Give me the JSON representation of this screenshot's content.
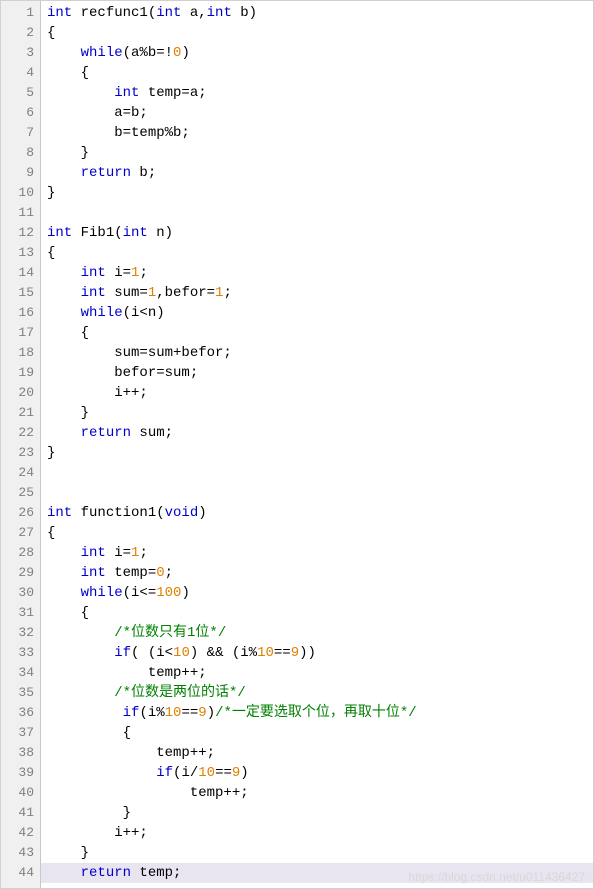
{
  "watermark": "https://blog.csdn.net/u011436427",
  "lines": [
    {
      "n": 1,
      "indent": 0,
      "segs": [
        {
          "t": "int ",
          "c": "kw"
        },
        {
          "t": "recfunc1(",
          "c": ""
        },
        {
          "t": "int ",
          "c": "kw"
        },
        {
          "t": "a,",
          "c": ""
        },
        {
          "t": "int ",
          "c": "kw"
        },
        {
          "t": "b)",
          "c": ""
        }
      ]
    },
    {
      "n": 2,
      "indent": 0,
      "segs": [
        {
          "t": "{",
          "c": ""
        }
      ]
    },
    {
      "n": 3,
      "indent": 1,
      "segs": [
        {
          "t": "while",
          "c": "kw"
        },
        {
          "t": "(a%b=!",
          "c": ""
        },
        {
          "t": "0",
          "c": "num"
        },
        {
          "t": ")",
          "c": ""
        }
      ]
    },
    {
      "n": 4,
      "indent": 1,
      "segs": [
        {
          "t": "{",
          "c": ""
        }
      ]
    },
    {
      "n": 5,
      "indent": 2,
      "segs": [
        {
          "t": "int ",
          "c": "kw"
        },
        {
          "t": "temp=a;",
          "c": ""
        }
      ]
    },
    {
      "n": 6,
      "indent": 2,
      "segs": [
        {
          "t": "a=b;",
          "c": ""
        }
      ]
    },
    {
      "n": 7,
      "indent": 2,
      "segs": [
        {
          "t": "b=temp%b;",
          "c": ""
        }
      ]
    },
    {
      "n": 8,
      "indent": 1,
      "segs": [
        {
          "t": "}",
          "c": ""
        }
      ]
    },
    {
      "n": 9,
      "indent": 1,
      "segs": [
        {
          "t": "return ",
          "c": "kw"
        },
        {
          "t": "b;",
          "c": ""
        }
      ]
    },
    {
      "n": 10,
      "indent": 0,
      "segs": [
        {
          "t": "}",
          "c": ""
        }
      ]
    },
    {
      "n": 11,
      "indent": 0,
      "segs": []
    },
    {
      "n": 12,
      "indent": 0,
      "segs": [
        {
          "t": "int ",
          "c": "kw"
        },
        {
          "t": "Fib1(",
          "c": ""
        },
        {
          "t": "int ",
          "c": "kw"
        },
        {
          "t": "n)",
          "c": ""
        }
      ]
    },
    {
      "n": 13,
      "indent": 0,
      "segs": [
        {
          "t": "{",
          "c": ""
        }
      ]
    },
    {
      "n": 14,
      "indent": 1,
      "segs": [
        {
          "t": "int ",
          "c": "kw"
        },
        {
          "t": "i=",
          "c": ""
        },
        {
          "t": "1",
          "c": "num"
        },
        {
          "t": ";",
          "c": ""
        }
      ]
    },
    {
      "n": 15,
      "indent": 1,
      "segs": [
        {
          "t": "int ",
          "c": "kw"
        },
        {
          "t": "sum=",
          "c": ""
        },
        {
          "t": "1",
          "c": "num"
        },
        {
          "t": ",befor=",
          "c": ""
        },
        {
          "t": "1",
          "c": "num"
        },
        {
          "t": ";",
          "c": ""
        }
      ]
    },
    {
      "n": 16,
      "indent": 1,
      "segs": [
        {
          "t": "while",
          "c": "kw"
        },
        {
          "t": "(i<n)",
          "c": ""
        }
      ]
    },
    {
      "n": 17,
      "indent": 1,
      "segs": [
        {
          "t": "{",
          "c": ""
        }
      ]
    },
    {
      "n": 18,
      "indent": 2,
      "segs": [
        {
          "t": "sum=sum+befor;",
          "c": ""
        }
      ]
    },
    {
      "n": 19,
      "indent": 2,
      "segs": [
        {
          "t": "befor=sum;",
          "c": ""
        }
      ]
    },
    {
      "n": 20,
      "indent": 2,
      "segs": [
        {
          "t": "i++;",
          "c": ""
        }
      ]
    },
    {
      "n": 21,
      "indent": 1,
      "segs": [
        {
          "t": "}",
          "c": ""
        }
      ]
    },
    {
      "n": 22,
      "indent": 1,
      "segs": [
        {
          "t": "return ",
          "c": "kw"
        },
        {
          "t": "sum;",
          "c": ""
        }
      ]
    },
    {
      "n": 23,
      "indent": 0,
      "segs": [
        {
          "t": "}",
          "c": ""
        }
      ]
    },
    {
      "n": 24,
      "indent": 0,
      "segs": []
    },
    {
      "n": 25,
      "indent": 0,
      "segs": []
    },
    {
      "n": 26,
      "indent": 0,
      "segs": [
        {
          "t": "int ",
          "c": "kw"
        },
        {
          "t": "function1(",
          "c": ""
        },
        {
          "t": "void",
          "c": "kw"
        },
        {
          "t": ")",
          "c": ""
        }
      ]
    },
    {
      "n": 27,
      "indent": 0,
      "segs": [
        {
          "t": "{",
          "c": ""
        }
      ]
    },
    {
      "n": 28,
      "indent": 1,
      "segs": [
        {
          "t": "int ",
          "c": "kw"
        },
        {
          "t": "i=",
          "c": ""
        },
        {
          "t": "1",
          "c": "num"
        },
        {
          "t": ";",
          "c": ""
        }
      ]
    },
    {
      "n": 29,
      "indent": 1,
      "segs": [
        {
          "t": "int ",
          "c": "kw"
        },
        {
          "t": "temp=",
          "c": ""
        },
        {
          "t": "0",
          "c": "num"
        },
        {
          "t": ";",
          "c": ""
        }
      ]
    },
    {
      "n": 30,
      "indent": 1,
      "segs": [
        {
          "t": "while",
          "c": "kw"
        },
        {
          "t": "(i<=",
          "c": ""
        },
        {
          "t": "100",
          "c": "num"
        },
        {
          "t": ")",
          "c": ""
        }
      ]
    },
    {
      "n": 31,
      "indent": 1,
      "segs": [
        {
          "t": "{",
          "c": ""
        }
      ]
    },
    {
      "n": 32,
      "indent": 2,
      "segs": [
        {
          "t": "/*位数只有1位*/",
          "c": "comment"
        }
      ]
    },
    {
      "n": 33,
      "indent": 2,
      "segs": [
        {
          "t": "if",
          "c": "kw"
        },
        {
          "t": "( (i<",
          "c": ""
        },
        {
          "t": "10",
          "c": "num"
        },
        {
          "t": ") && (i%",
          "c": ""
        },
        {
          "t": "10",
          "c": "num"
        },
        {
          "t": "==",
          "c": ""
        },
        {
          "t": "9",
          "c": "num"
        },
        {
          "t": "))",
          "c": ""
        }
      ]
    },
    {
      "n": 34,
      "indent": 3,
      "segs": [
        {
          "t": "temp++;",
          "c": ""
        }
      ]
    },
    {
      "n": 35,
      "indent": 2,
      "segs": [
        {
          "t": "/*位数是两位的话*/",
          "c": "comment"
        }
      ]
    },
    {
      "n": 36,
      "indent": 2,
      "segs": [
        {
          "t": " ",
          "c": ""
        },
        {
          "t": "if",
          "c": "kw"
        },
        {
          "t": "(i%",
          "c": ""
        },
        {
          "t": "10",
          "c": "num"
        },
        {
          "t": "==",
          "c": ""
        },
        {
          "t": "9",
          "c": "num"
        },
        {
          "t": ")",
          "c": ""
        },
        {
          "t": "/*一定要选取个位，再取十位*/",
          "c": "comment"
        }
      ]
    },
    {
      "n": 37,
      "indent": 2,
      "segs": [
        {
          "t": " {",
          "c": ""
        }
      ]
    },
    {
      "n": 38,
      "indent": 3,
      "segs": [
        {
          "t": " temp++;",
          "c": ""
        }
      ]
    },
    {
      "n": 39,
      "indent": 3,
      "segs": [
        {
          "t": " ",
          "c": ""
        },
        {
          "t": "if",
          "c": "kw"
        },
        {
          "t": "(i/",
          "c": ""
        },
        {
          "t": "10",
          "c": "num"
        },
        {
          "t": "==",
          "c": ""
        },
        {
          "t": "9",
          "c": "num"
        },
        {
          "t": ")",
          "c": ""
        }
      ]
    },
    {
      "n": 40,
      "indent": 4,
      "segs": [
        {
          "t": " temp++;",
          "c": ""
        }
      ]
    },
    {
      "n": 41,
      "indent": 2,
      "segs": [
        {
          "t": " }",
          "c": ""
        }
      ]
    },
    {
      "n": 42,
      "indent": 2,
      "segs": [
        {
          "t": "i++;",
          "c": ""
        }
      ]
    },
    {
      "n": 43,
      "indent": 1,
      "segs": [
        {
          "t": "}",
          "c": ""
        }
      ]
    },
    {
      "n": 44,
      "indent": 1,
      "hl": true,
      "segs": [
        {
          "t": "return ",
          "c": "kw"
        },
        {
          "t": "temp;",
          "c": ""
        }
      ]
    }
  ]
}
